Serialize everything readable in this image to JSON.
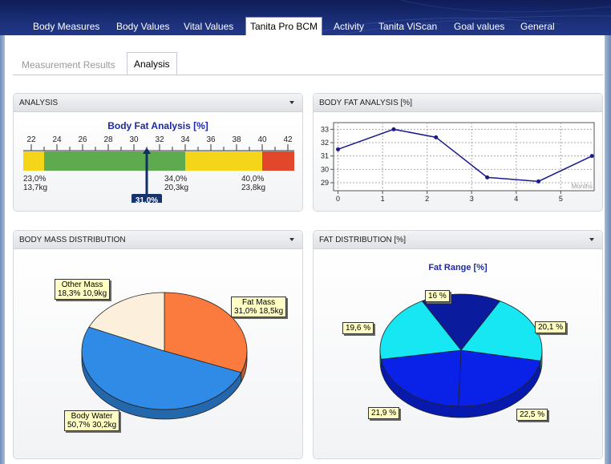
{
  "top_tabs": [
    "Body Measures",
    "Body Values",
    "Vital Values",
    "Tanita Pro BCM",
    "Activity",
    "Tanita ViScan",
    "Goal values",
    "General"
  ],
  "sub_tabs": [
    "Measurement Results",
    "Analysis"
  ],
  "analysis_panel": {
    "header": "ANALYSIS",
    "title": "Body Fat Analysis [%]",
    "ticks": [
      "22",
      "24",
      "26",
      "28",
      "30",
      "32",
      "34",
      "36",
      "38",
      "40",
      "42"
    ],
    "ranges": [
      {
        "from": 22,
        "to": 23,
        "color": "#f5d51a"
      },
      {
        "from": 23,
        "to": 34,
        "color": "#5daa4f"
      },
      {
        "from": 34,
        "to": 40,
        "color": "#f5d51a"
      },
      {
        "from": 40,
        "to": 42.5,
        "color": "#e2462b"
      }
    ],
    "thresholds": [
      {
        "pct": "23,0%",
        "kg": "13,7kg"
      },
      {
        "pct": "34,0%",
        "kg": "20,3kg"
      },
      {
        "pct": "40,0%",
        "kg": "23,8kg"
      }
    ],
    "current_value": 31.0,
    "current_label": "31,0%"
  },
  "body_fat_panel": {
    "header": "BODY FAT ANALYSIS [%]",
    "chart_data": {
      "type": "line",
      "x": [
        0,
        1.25,
        2.2,
        3.35,
        4.5,
        5.7
      ],
      "y": [
        31.5,
        33.0,
        32.4,
        29.4,
        29.1,
        31.0
      ],
      "xlim": [
        -0.1,
        5.75
      ],
      "ylim": [
        28.4,
        33.5
      ],
      "xticks": [
        "0",
        "1",
        "2",
        "3",
        "4",
        "5"
      ],
      "yticks": [
        "29",
        "30",
        "31",
        "32",
        "33"
      ],
      "xlabel": "Months",
      "grid": true,
      "line_color": "#1a1a8c"
    }
  },
  "mass_panel": {
    "header": "BODY MASS DISTRIBUTION",
    "chart_data": {
      "type": "pie",
      "labels": [
        "Fat Mass",
        "Body Water",
        "Other Mass"
      ],
      "values": [
        31.0,
        50.7,
        18.3
      ],
      "kg": [
        "18,5kg",
        "30,2kg",
        "10,9kg"
      ],
      "colors": [
        "#fb7b3e",
        "#2f8be6",
        "#fcf0dc"
      ]
    },
    "callouts": [
      {
        "line1": "Fat Mass",
        "line2": "31,0% 18,5kg"
      },
      {
        "line1": "Body Water",
        "line2": "50,7% 30,2kg"
      },
      {
        "line1": "Other Mass",
        "line2": "18,3% 10,9kg"
      }
    ]
  },
  "fat_dist_panel": {
    "header": "FAT DISTRIBUTION [%]",
    "title": "Fat Range [%]",
    "chart_data": {
      "type": "pie",
      "labels": [
        "16 %",
        "20,1 %",
        "22,5 %",
        "21,9 %",
        "19,6 %"
      ],
      "values": [
        16,
        20.1,
        22.5,
        21.9,
        19.6
      ],
      "colors": [
        "#0b1b9e",
        "#17e6f3",
        "#0a22e8",
        "#0a22e8",
        "#17e6f3"
      ]
    }
  }
}
